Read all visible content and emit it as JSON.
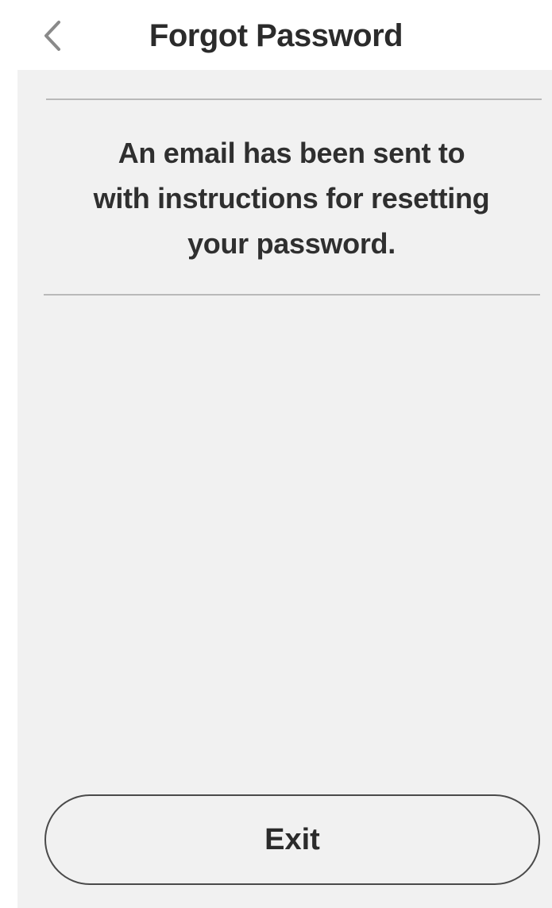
{
  "header": {
    "back_icon": "chevron-left-icon",
    "title": "Forgot Password"
  },
  "message": {
    "line1": "An email has been sent to",
    "line2": "with instructions for resetting",
    "line3": "your password."
  },
  "actions": {
    "exit_label": "Exit"
  },
  "colors": {
    "background": "#f1f1f1",
    "header_background": "#ffffff",
    "text": "#2f2f2f",
    "divider": "#b9b9b9",
    "button_border": "#4a4a4a"
  }
}
